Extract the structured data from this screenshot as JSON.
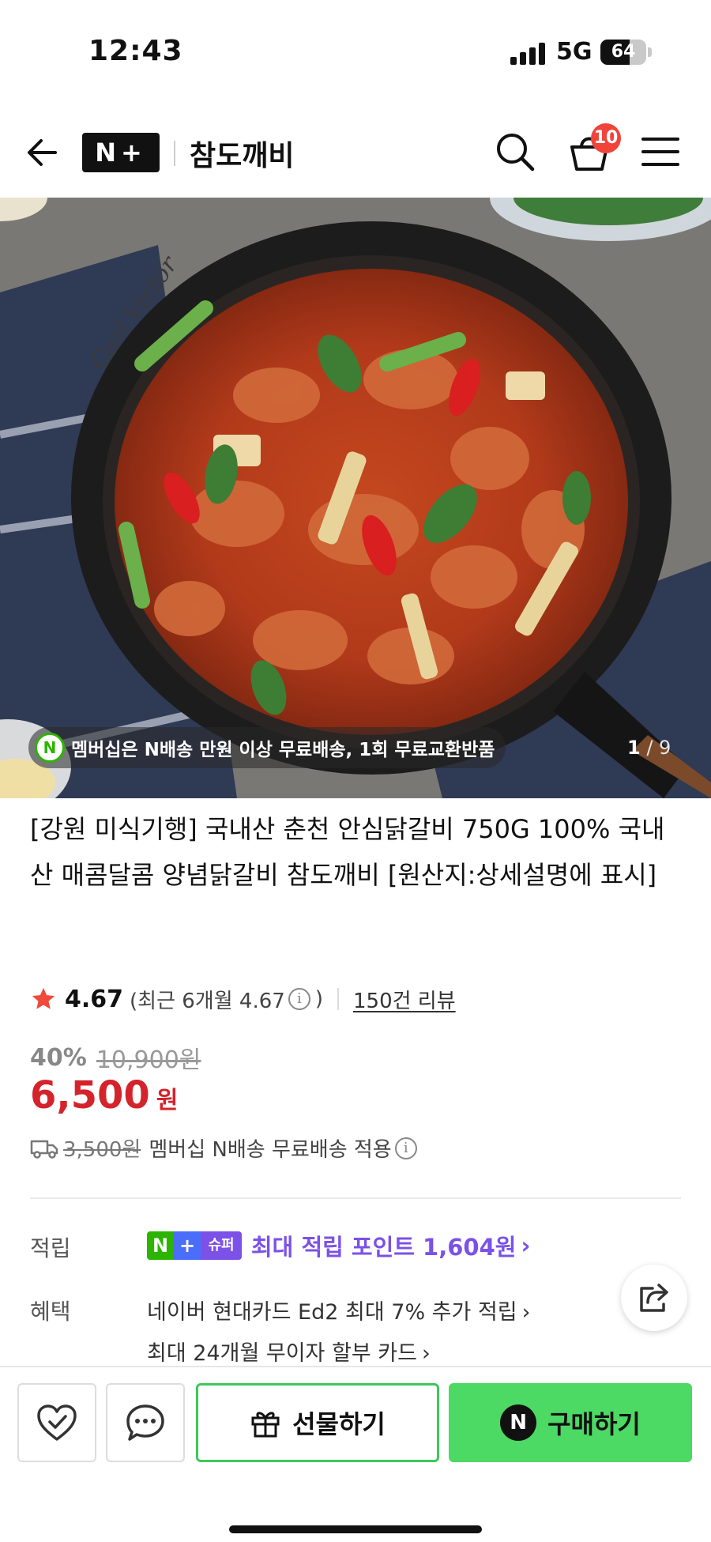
{
  "status_bar": {
    "time": "12:43",
    "network": "5G",
    "battery": "64",
    "battery_level": 0.64
  },
  "header": {
    "logo": "N+",
    "store_name": "참도깨비",
    "cart_count": "10"
  },
  "hero": {
    "member_badge": "N",
    "member_text": "멤버십은 N배송 만원 이상 무료배송, 1회 무료교환반품",
    "pan_brand": "Carl Victor",
    "page_current": "1",
    "page_sep": " / ",
    "page_total": "9"
  },
  "product": {
    "title": "[강원 미식기행] 국내산 춘천 안심닭갈비 750G 100% 국내산 매콤달콤 양념닭갈비 참도깨비 [원산지:상세설명에 표시]",
    "rating": "4.67",
    "recent_rating_open": "(최근 6개월 4.67",
    "recent_rating_close": ")",
    "reviews": "150건 리뷰",
    "discount_pct": "40%",
    "original_price": "10,900원",
    "price": "6,500",
    "price_unit": "원",
    "ship_old_fee": "3,500원",
    "ship_text": "멤버십 N배송 무료배송 적용"
  },
  "rewards": {
    "label": "적립",
    "badge_n": "N",
    "badge_plus": "+",
    "badge_super": "슈퍼",
    "text": "최대 적립 포인트 1,604원",
    "chevron": "›"
  },
  "benefits": {
    "label": "혜택",
    "items": [
      "네이버 현대카드 Ed2 최대 7% 추가 적립",
      "최대 24개월 무이자 할부 카드"
    ],
    "chevron": "›"
  },
  "bottom_bar": {
    "gift_label": "선물하기",
    "buy_badge": "N",
    "buy_label": "구매하기"
  },
  "colors": {
    "price_red": "#d4232b",
    "buy_green": "#4cd964",
    "reward_purple": "#7b51e8",
    "naver_green": "#2db400"
  }
}
